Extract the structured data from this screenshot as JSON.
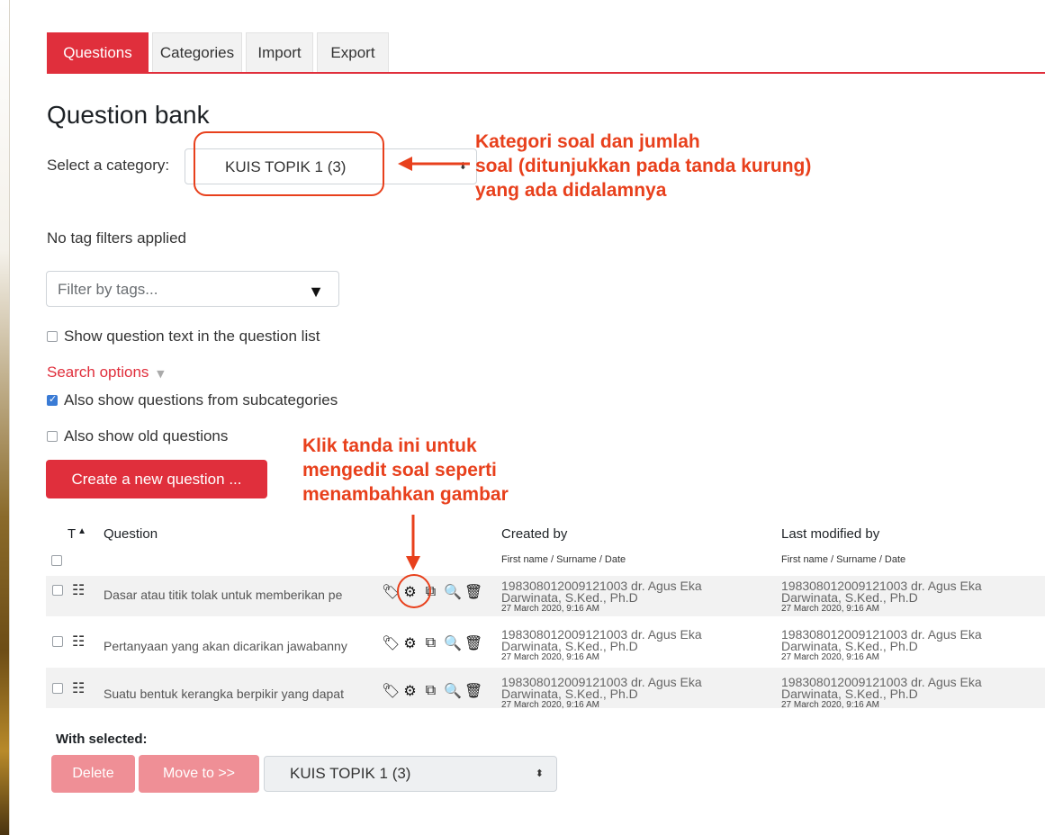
{
  "tabs": [
    "Questions",
    "Categories",
    "Import",
    "Export"
  ],
  "page_title": "Question bank",
  "category": {
    "label": "Select a category:",
    "value": "KUIS TOPIK 1 (3)"
  },
  "tag_filters_text": "No tag filters applied",
  "filter_placeholder": "Filter by tags...",
  "show_question_text_label": "Show question text in the question list",
  "search_options_label": "Search options",
  "subcategories_label": "Also show questions from subcategories",
  "old_questions_label": "Also show old questions",
  "create_button": "Create a new question ...",
  "table": {
    "col_type": "T",
    "col_question": "Question",
    "col_created": "Created by",
    "col_modified": "Last modified by",
    "sub_created": "First name / Surname / Date",
    "sub_modified": "First name / Surname / Date",
    "rows": [
      {
        "question": "Dasar atau titik tolak untuk memberikan pe",
        "created_line1": "198308012009121003 dr. Agus Eka",
        "created_line2": "Darwinata, S.Ked., Ph.D",
        "created_date": "27 March 2020, 9:16 AM",
        "modified_line1": "198308012009121003 dr. Agus Eka",
        "modified_line2": "Darwinata, S.Ked., Ph.D",
        "modified_date": "27 March 2020, 9:16 AM"
      },
      {
        "question": "Pertanyaan yang akan dicarikan jawabanny",
        "created_line1": "198308012009121003 dr. Agus Eka",
        "created_line2": "Darwinata, S.Ked., Ph.D",
        "created_date": "27 March 2020, 9:16 AM",
        "modified_line1": "198308012009121003 dr. Agus Eka",
        "modified_line2": "Darwinata, S.Ked., Ph.D",
        "modified_date": "27 March 2020, 9:16 AM"
      },
      {
        "question": "Suatu bentuk kerangka berpikir yang dapat",
        "created_line1": "198308012009121003 dr. Agus Eka",
        "created_line2": "Darwinata, S.Ked., Ph.D",
        "created_date": "27 March 2020, 9:16 AM",
        "modified_line1": "198308012009121003 dr. Agus Eka",
        "modified_line2": "Darwinata, S.Ked., Ph.D",
        "modified_date": "27 March 2020, 9:16 AM"
      }
    ]
  },
  "with_selected_label": "With selected:",
  "delete_button": "Delete",
  "move_button": "Move to >>",
  "move_target": "KUIS TOPIK 1 (3)",
  "annotations": {
    "category_note": [
      "Kategori soal dan jumlah",
      "soal (ditunjukkan pada tanda kurung)",
      "yang ada didalamnya"
    ],
    "edit_note": [
      "Klik tanda ini untuk",
      "mengedit soal seperti",
      "menambahkan gambar"
    ]
  },
  "colors": {
    "accent": "#e02f3c",
    "annotation": "#e8401c",
    "disabled_button": "#ef8f96"
  }
}
